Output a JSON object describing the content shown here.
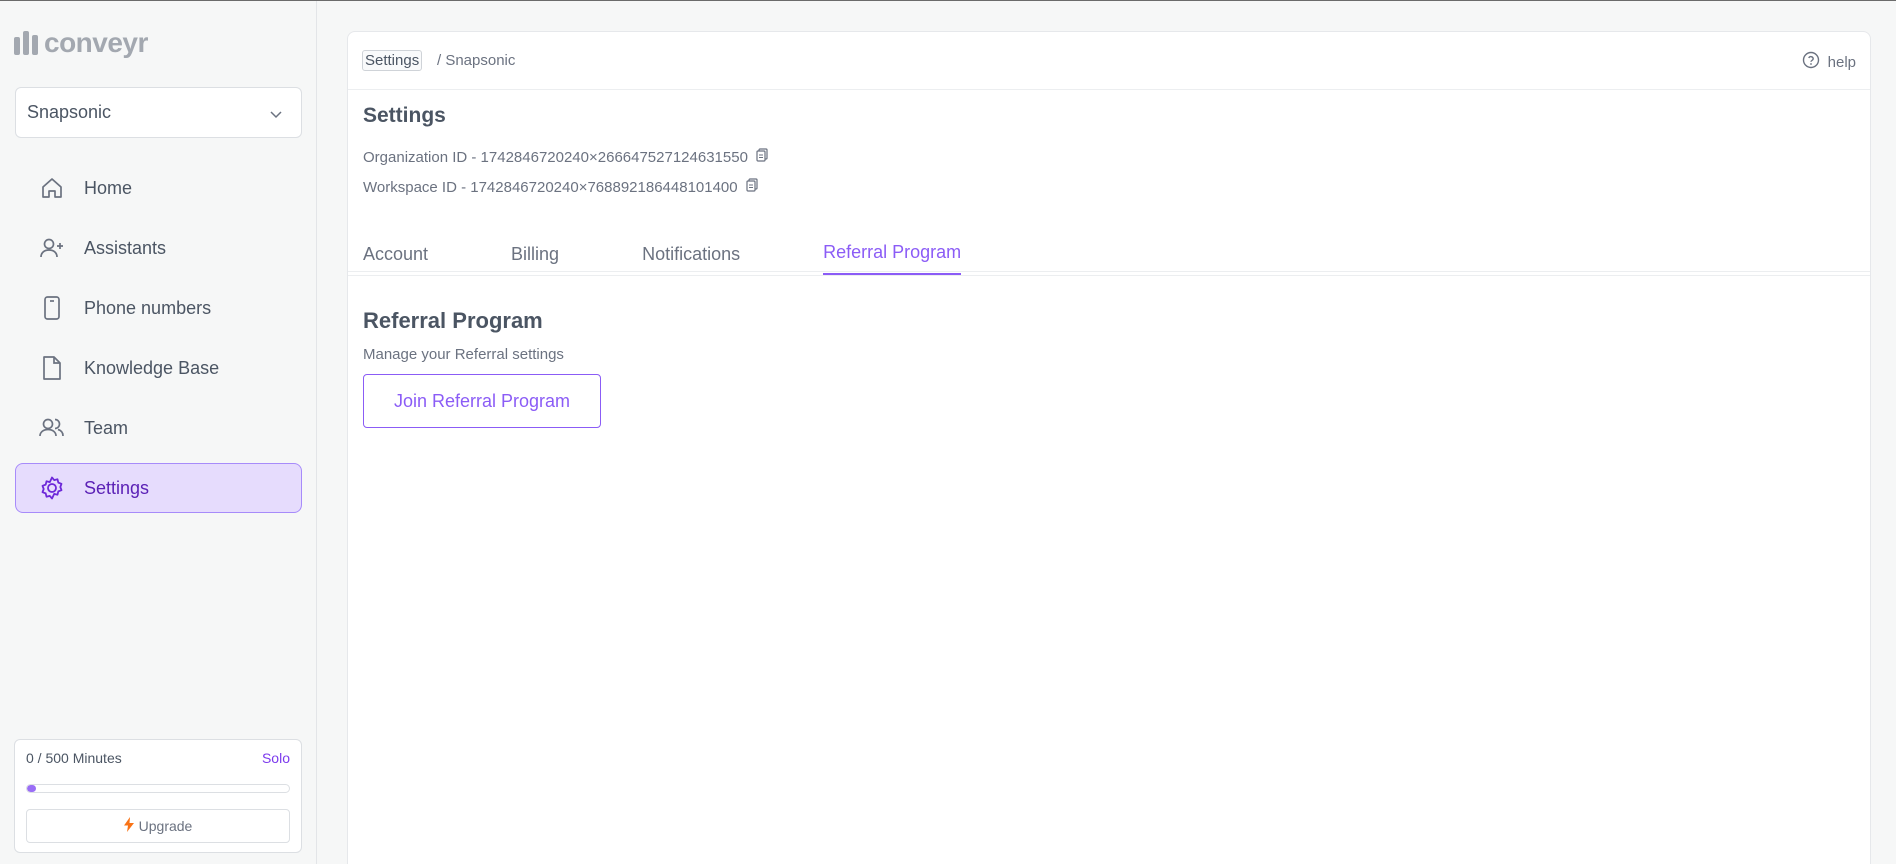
{
  "brand": {
    "name": "conveyr"
  },
  "workspace": {
    "selected": "Snapsonic"
  },
  "nav": {
    "items": [
      {
        "label": "Home",
        "icon": "home-icon"
      },
      {
        "label": "Assistants",
        "icon": "user-plus-icon"
      },
      {
        "label": "Phone numbers",
        "icon": "phone-icon"
      },
      {
        "label": "Knowledge Base",
        "icon": "file-icon"
      },
      {
        "label": "Team",
        "icon": "users-icon"
      },
      {
        "label": "Settings",
        "icon": "gear-icon",
        "active": true
      }
    ]
  },
  "usage": {
    "text": "0 / 500 Minutes",
    "plan": "Solo",
    "used": 0,
    "total": 500,
    "upgrade_label": "Upgrade"
  },
  "breadcrumb": {
    "root": "Settings",
    "current": "/ Snapsonic"
  },
  "help_label": "help",
  "page": {
    "title": "Settings",
    "organization_id": "Organization ID - 1742846720240×266647527124631550",
    "workspace_id": "Workspace ID - 1742846720240×768892186448101400"
  },
  "tabs": [
    {
      "label": "Account"
    },
    {
      "label": "Billing"
    },
    {
      "label": "Notifications"
    },
    {
      "label": "Referral Program",
      "active": true
    }
  ],
  "referral": {
    "title": "Referral Program",
    "description": "Manage your Referral settings",
    "button_label": "Join Referral Program"
  },
  "colors": {
    "accent": "#8b5cf6",
    "active_nav_bg": "#e6dcfd",
    "upgrade_icon": "#f97316"
  }
}
